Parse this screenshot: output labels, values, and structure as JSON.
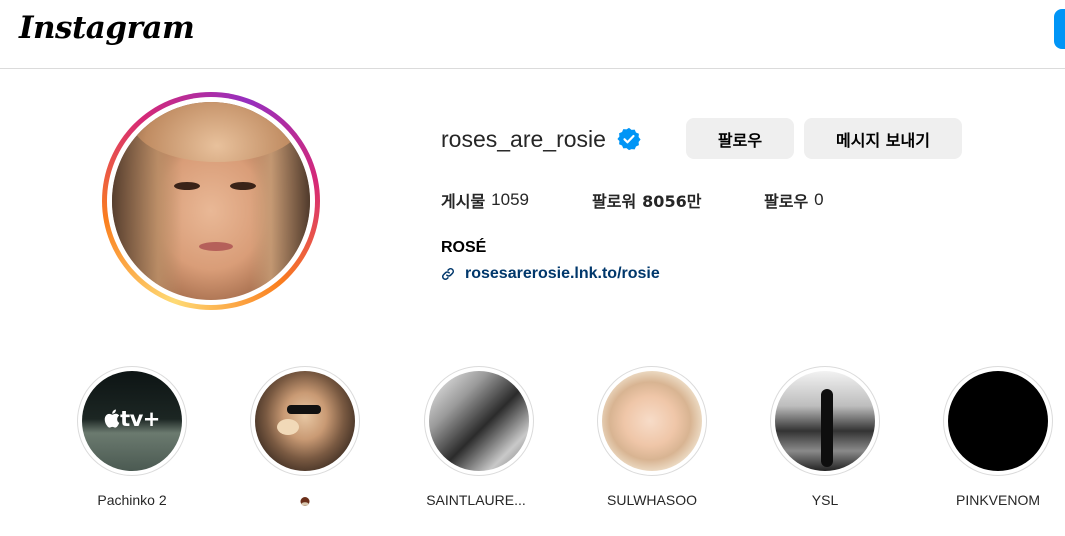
{
  "header": {
    "logo": "Instagram"
  },
  "profile": {
    "username": "roses_are_rosie",
    "verified": true,
    "follow_label": "팔로우",
    "message_label": "메시지 보내기",
    "stats": {
      "posts_label": "게시물",
      "posts_value": "1059",
      "followers_label": "팔로워",
      "followers_value": "8056만",
      "following_label": "팔로우",
      "following_value": "0"
    },
    "full_name": "ROSÉ",
    "link": "rosesarerosie.lnk.to/rosie"
  },
  "highlights": [
    {
      "label": "Pachinko 2",
      "cover_text": "tv+"
    },
    {
      "label": ""
    },
    {
      "label": "SAINTLAURE..."
    },
    {
      "label": "SULWHASOO"
    },
    {
      "label": "YSL"
    },
    {
      "label": "PINKVENOM"
    }
  ],
  "colors": {
    "link": "#00376b",
    "verified": "#0095f6",
    "button_bg": "#efefef",
    "primary_blue": "#0095f6"
  }
}
